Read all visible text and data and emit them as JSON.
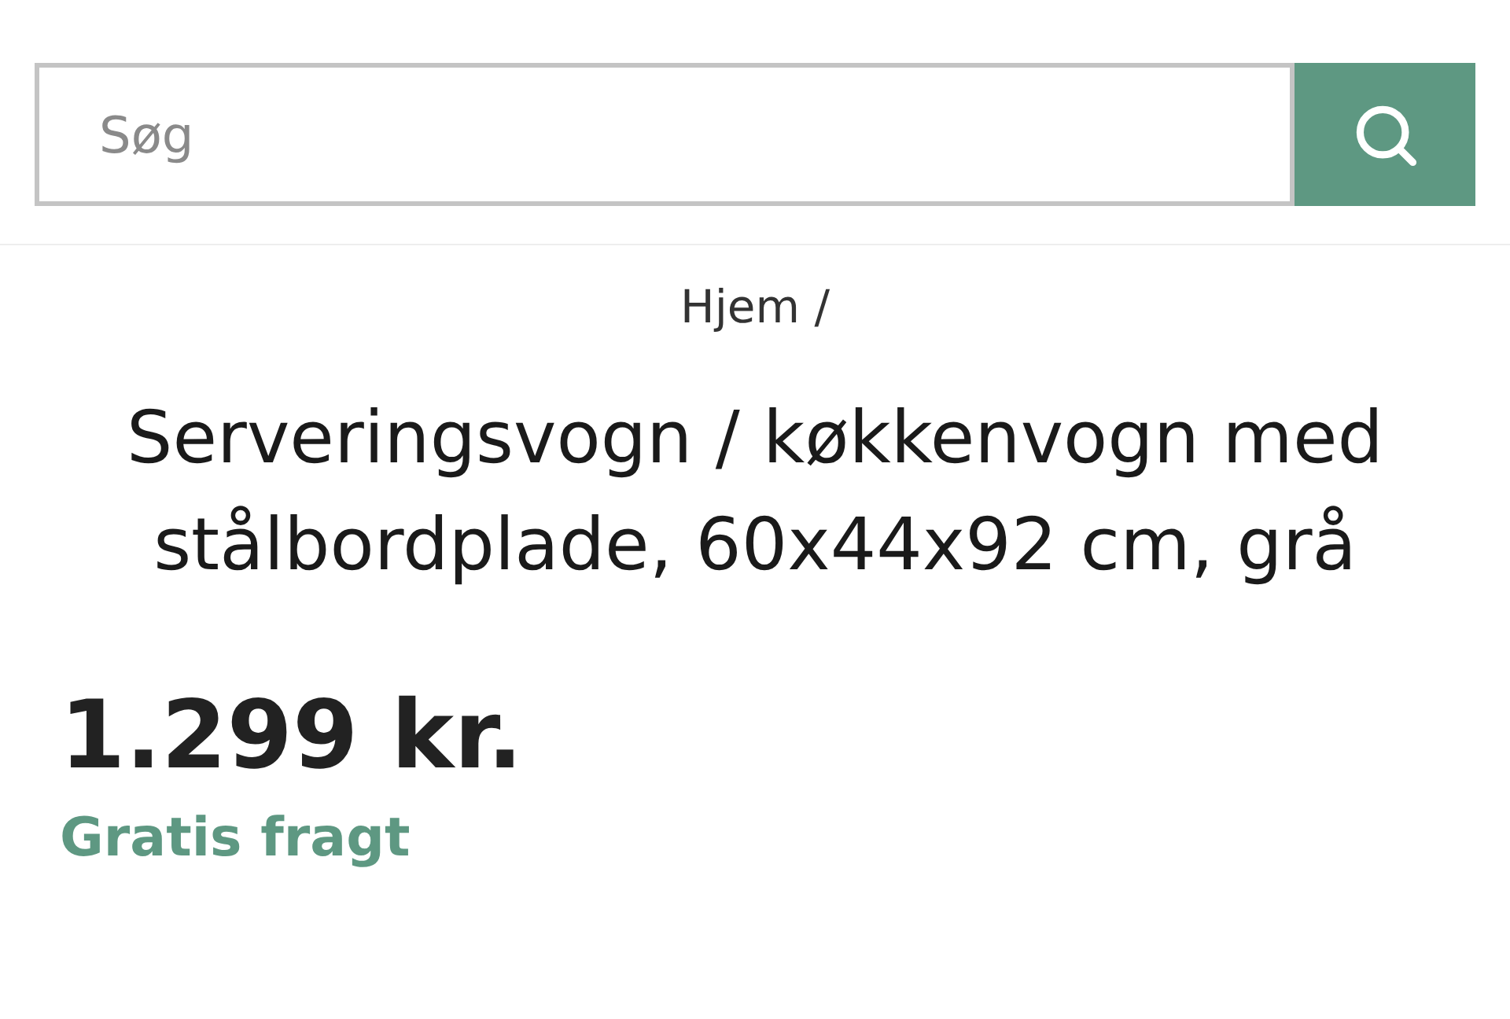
{
  "search": {
    "placeholder": "Søg"
  },
  "breadcrumb": [
    "Hjem /"
  ],
  "product": {
    "title": "Serveringsvogn / køkkenvogn med stålbordplade, 60x44x92 cm, grå",
    "price": "1.299 kr.",
    "shipping": "Gratis fragt"
  }
}
